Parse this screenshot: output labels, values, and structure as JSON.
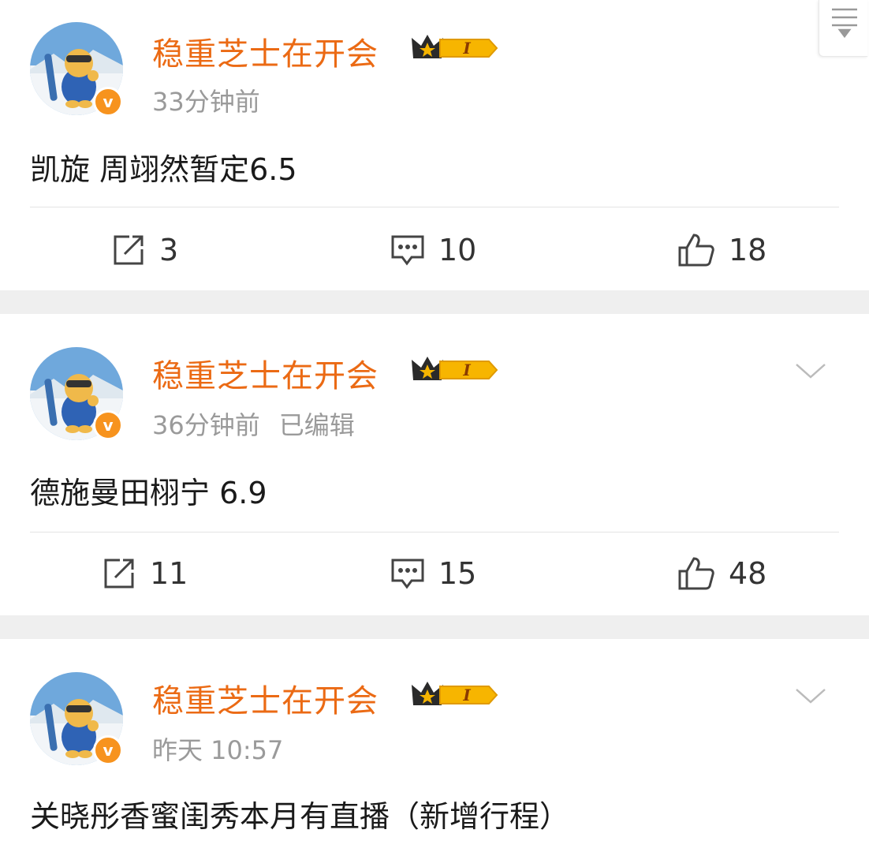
{
  "posts": [
    {
      "username": "稳重芝士在开会",
      "level": "I",
      "time": "33分钟前",
      "edited": "",
      "text": "凯旋 周翊然暂定6.5",
      "reposts": "3",
      "comments": "10",
      "likes": "18"
    },
    {
      "username": "稳重芝士在开会",
      "level": "I",
      "time": "36分钟前",
      "edited": "已编辑",
      "text": "德施曼田栩宁 6.9",
      "reposts": "11",
      "comments": "15",
      "likes": "48"
    },
    {
      "username": "稳重芝士在开会",
      "level": "I",
      "time": "昨天 10:57",
      "edited": "",
      "text": "关晓彤香蜜闺秀本月有直播（新增行程）"
    }
  ],
  "verified_badge": "v",
  "colors": {
    "username": "#eb6a14",
    "badge": "#f7931e",
    "meta": "#9a9a9a",
    "background": "#efefef"
  },
  "icons": [
    "avatar",
    "crown-level-icon",
    "chevron-down-icon",
    "repost-icon",
    "comment-icon",
    "like-icon",
    "filter-icon"
  ]
}
